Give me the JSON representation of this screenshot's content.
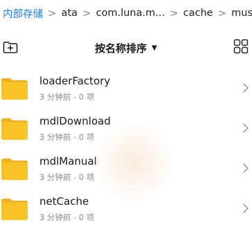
{
  "breadcrumb": {
    "items": [
      "内部存储",
      "ata",
      "com.luna.m...",
      "cache",
      "music"
    ],
    "separator": ">"
  },
  "toolbar": {
    "sort_label": "按名称排序",
    "sort_caret": "▼",
    "new_folder_icon": "new-folder-icon",
    "view_icon": "grid-view-icon"
  },
  "files": [
    {
      "name": "loaderFactory",
      "meta": "3 分钟前 - 0 项"
    },
    {
      "name": "mdlDownload",
      "meta": "3 分钟前 - 0 项"
    },
    {
      "name": "mdlManual",
      "meta": "3 分钟前 - 0 项"
    },
    {
      "name": "netCache",
      "meta": "3 分钟前 - 0 项"
    }
  ],
  "colors": {
    "accent": "#1e7cf2",
    "folder": "#f7c326",
    "folder_tab": "#efb21c",
    "secondary_text": "#8a8a8a"
  }
}
